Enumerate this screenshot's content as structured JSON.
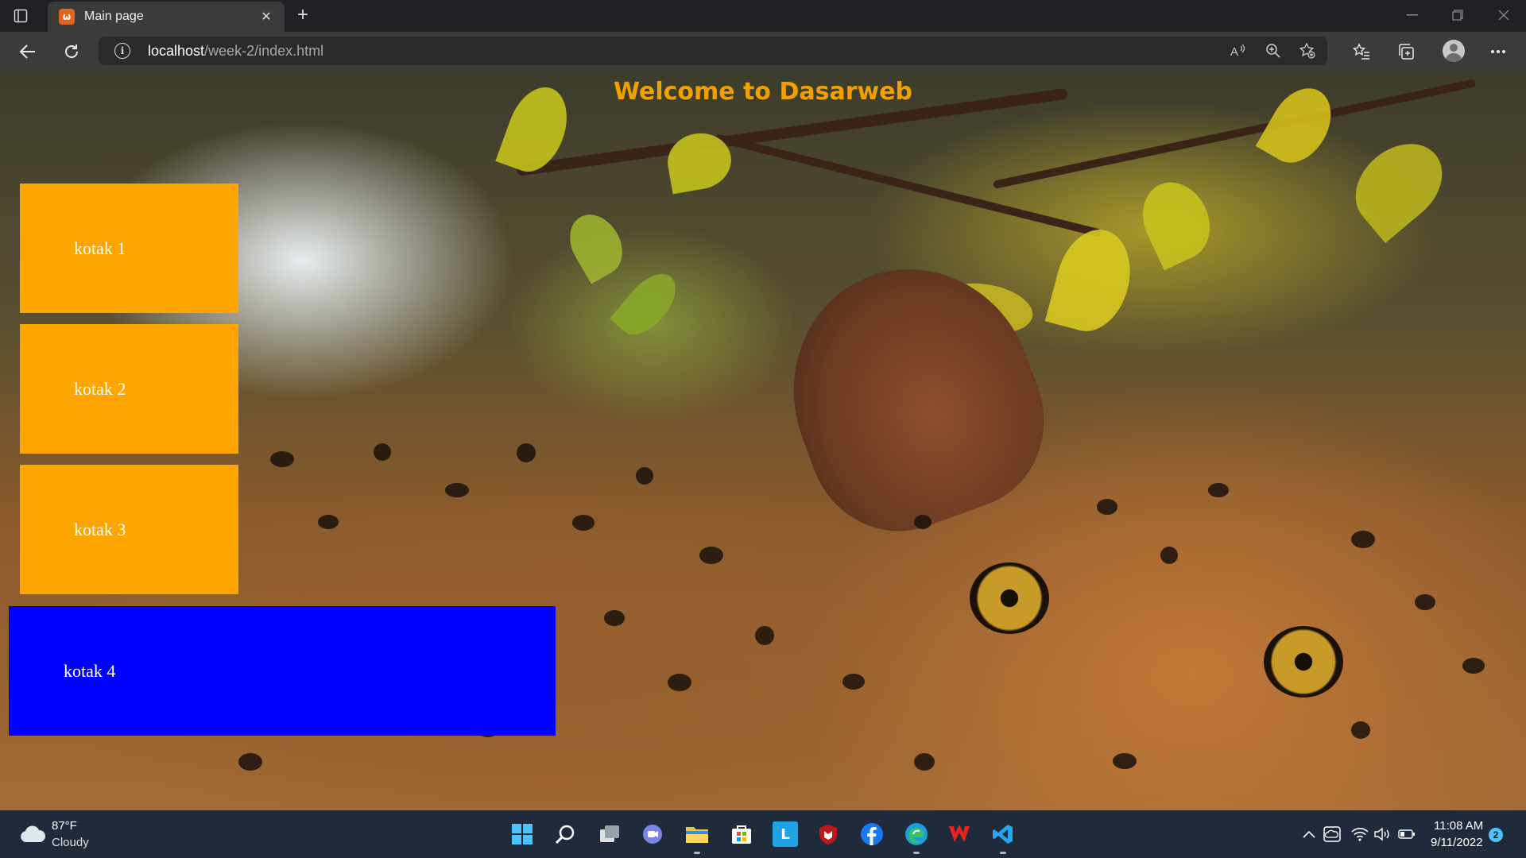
{
  "browser": {
    "tab": {
      "title": "Main page",
      "favicon_icon": "xampp-icon",
      "close_icon": "close-icon"
    },
    "new_tab_icon": "plus-icon",
    "address": {
      "host": "localhost",
      "path": "/week-2/index.html"
    },
    "toolbar_icons": [
      "back-icon",
      "refresh-icon",
      "info-icon",
      "read-aloud-icon",
      "zoom-icon",
      "add-favorite-icon",
      "favorites-icon",
      "collections-icon",
      "profile-icon",
      "more-icon"
    ]
  },
  "page": {
    "title": "Welcome to Dasarweb",
    "boxes": [
      {
        "label": "kotak 1",
        "color": "#ffa500"
      },
      {
        "label": "kotak 2",
        "color": "#ffa500"
      },
      {
        "label": "kotak 3",
        "color": "#ffa500"
      },
      {
        "label": "kotak 4",
        "color": "#0000ff"
      }
    ],
    "title_color": "#f2a000"
  },
  "taskbar": {
    "weather": {
      "temp": "87°F",
      "condition": "Cloudy"
    },
    "apps": [
      "windows-start-icon",
      "search-icon",
      "task-view-icon",
      "teams-chat-icon",
      "file-explorer-icon",
      "microsoft-store-icon",
      "l-app-icon",
      "mcafee-icon",
      "facebook-icon",
      "edge-icon",
      "wps-office-icon",
      "vscode-icon"
    ],
    "clock": {
      "time": "11:08 AM",
      "date": "9/11/2022"
    },
    "notifications": "2"
  }
}
